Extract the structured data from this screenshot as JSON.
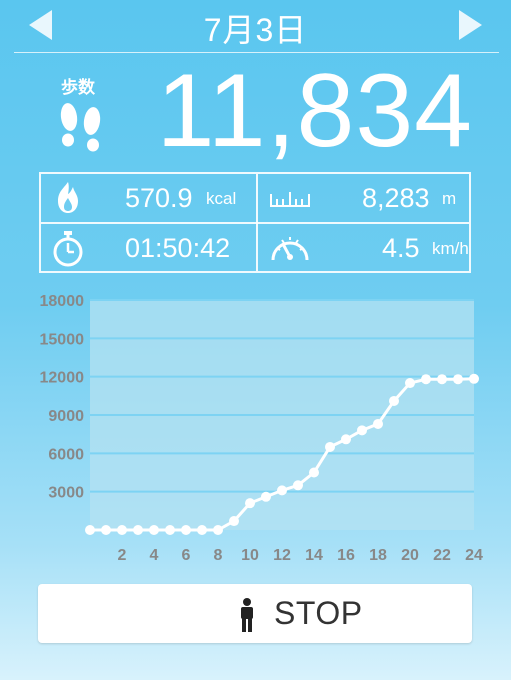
{
  "header": {
    "date": "7月3日"
  },
  "steps": {
    "label": "歩数",
    "value": "11,834"
  },
  "stats": {
    "calories": {
      "value": "570.9",
      "unit": "kcal"
    },
    "distance": {
      "value": "8,283",
      "unit": "m"
    },
    "time": {
      "value": "01:50:42"
    },
    "speed": {
      "value": "4.5",
      "unit": "km/h"
    }
  },
  "chart_data": {
    "type": "line",
    "x": [
      0,
      1,
      2,
      3,
      4,
      5,
      6,
      7,
      8,
      9,
      10,
      11,
      12,
      13,
      14,
      15,
      16,
      17,
      18,
      19,
      20,
      21,
      22,
      23,
      24
    ],
    "values": [
      0,
      0,
      0,
      0,
      0,
      0,
      0,
      0,
      0,
      700,
      2100,
      2600,
      3100,
      3500,
      4500,
      6500,
      7100,
      7800,
      8300,
      10100,
      11500,
      11800,
      11800,
      11800,
      11834
    ],
    "x_ticks": [
      "2",
      "4",
      "6",
      "8",
      "10",
      "12",
      "14",
      "16",
      "18",
      "20",
      "22",
      "24"
    ],
    "x_tick_values": [
      2,
      4,
      6,
      8,
      10,
      12,
      14,
      16,
      18,
      20,
      22,
      24
    ],
    "y_ticks": [
      "3000",
      "6000",
      "9000",
      "12000",
      "15000",
      "18000"
    ],
    "y_tick_values": [
      3000,
      6000,
      9000,
      12000,
      15000,
      18000
    ],
    "xlim": [
      0,
      24
    ],
    "ylim": [
      0,
      18000
    ],
    "grid": true,
    "colors": {
      "line": "#ffffff",
      "grid": "#7dd3f3",
      "plot_bg": "#b4e2f1",
      "tick_label": "#888888"
    }
  },
  "stop_button": {
    "label": "STOP"
  },
  "icons": [
    "chevron-left-icon",
    "chevron-right-icon",
    "footprints-icon",
    "flame-icon",
    "ruler-icon",
    "stopwatch-icon",
    "speedometer-icon",
    "person-icon"
  ]
}
